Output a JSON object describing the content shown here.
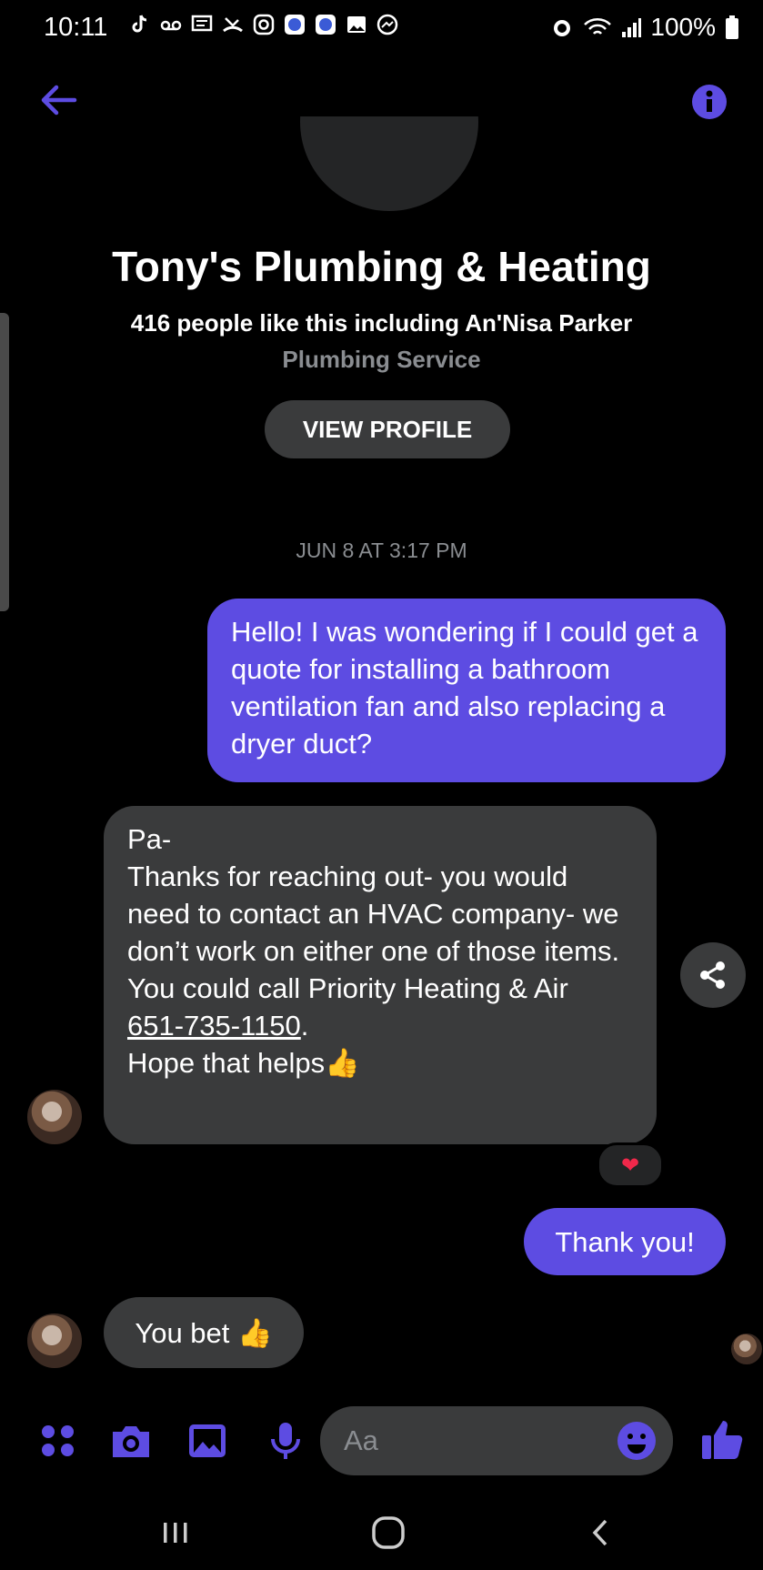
{
  "status_bar": {
    "time": "10:11",
    "battery": "100%",
    "notification_icons": [
      "tiktok-icon",
      "voicemail-icon",
      "message-icon",
      "missed-call-icon",
      "instagram-icon",
      "app-icon",
      "app-icon",
      "gallery-icon",
      "messenger-icon"
    ],
    "right_icons": [
      "alarm-icon",
      "wifi-icon",
      "signal-icon",
      "battery-icon"
    ]
  },
  "header": {
    "page_title": "Tony's Plumbing & Heating",
    "likes": "416 people like this including An'Nisa Parker",
    "category": "Plumbing Service",
    "view_profile_label": "VIEW PROFILE"
  },
  "conversation": {
    "timestamp": "JUN 8 AT 3:17 PM",
    "messages": [
      {
        "sender": "me",
        "text": "Hello! I was wondering if I could get a quote for installing a bathroom ventilation fan and also replacing a dryer duct?"
      },
      {
        "sender": "page",
        "text_before_phone": "Pa-\nThanks for reaching out- you would need to contact an HVAC company- we don’t work on either one of those items.\nYou could call Priority Heating & Air\n",
        "phone": "651-735-1150",
        "text_after_phone": ".\nHope that helps👍",
        "reaction": "❤"
      },
      {
        "sender": "me",
        "text": "Thank you!"
      },
      {
        "sender": "page",
        "text": "You bet 👍"
      }
    ]
  },
  "composer": {
    "placeholder": "Aa",
    "icons": [
      "more-icon",
      "camera-icon",
      "gallery-icon",
      "microphone-icon",
      "emoji-icon",
      "thumbs-up-icon"
    ]
  },
  "nav_bar": {
    "icons": [
      "recent-apps-icon",
      "home-icon",
      "back-icon"
    ]
  },
  "colors": {
    "accent": "#5d4ce2",
    "incoming_bubble": "#3a3b3c",
    "muted_text": "#8a8d91",
    "background": "#000000"
  }
}
